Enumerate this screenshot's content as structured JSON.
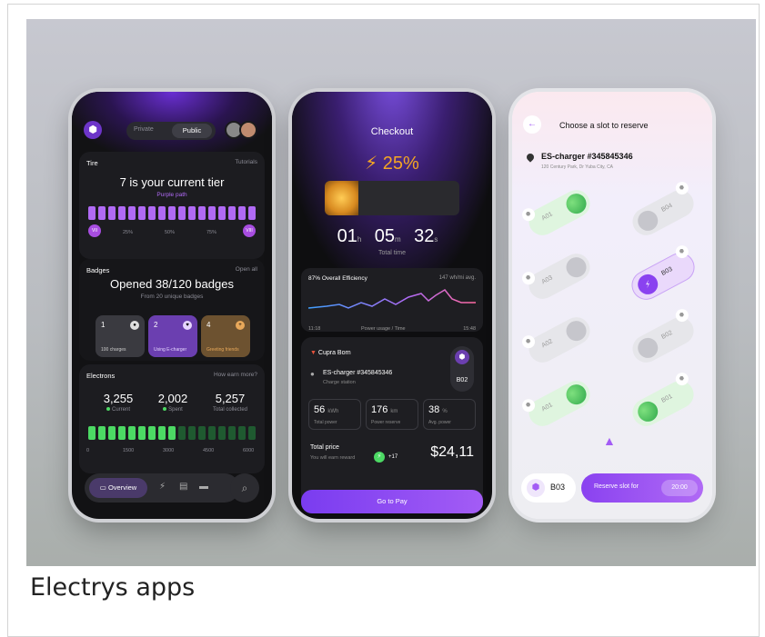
{
  "caption": "Electrys apps",
  "phone1": {
    "toggle": {
      "private_label": "Private",
      "public_label": "Public"
    },
    "tier_card": {
      "title": "Tire",
      "link": "Tutorials",
      "headline": "7 is your current tier",
      "subheadline": "Purple path",
      "scale": [
        "25%",
        "50%",
        "75%"
      ],
      "badge_start": "VII",
      "badge_end": "VIII",
      "progress_fraction": 1.0
    },
    "badges_card": {
      "title": "Badges",
      "link": "Open all",
      "headline": "Opened 38/120 badges",
      "subheadline": "From 20 unique badges",
      "tiles": [
        {
          "num": "1",
          "label": "100 charges",
          "color": "#3a3a40"
        },
        {
          "num": "2",
          "label": "Using E-charger",
          "color": "#6b3fb0"
        },
        {
          "num": "4",
          "label": "Greeting friends",
          "color": "#6d5230"
        }
      ]
    },
    "electrons_card": {
      "title": "Electrons",
      "link": "How earn more?",
      "stats": [
        {
          "value": "3,255",
          "label": "Current",
          "dot": "#4cd964"
        },
        {
          "value": "2,002",
          "label": "Spent",
          "dot": "#4cd964"
        },
        {
          "value": "5,257",
          "label": "Total collected",
          "dot": ""
        }
      ],
      "scale": [
        "0",
        "1500",
        "3000",
        "4500",
        "6000"
      ],
      "progress_fraction": 0.55
    },
    "nav": {
      "active_label": "Overview"
    }
  },
  "phone2": {
    "title": "Checkout",
    "percent": "25%",
    "battery_fraction": 0.25,
    "timer": {
      "h": "01",
      "h_unit": "h",
      "m": "05",
      "m_unit": "m",
      "s": "32",
      "s_unit": "s"
    },
    "timer_label": "Total time",
    "efficiency": {
      "title": "87% Overall Efficiency",
      "avg": "147 wh/mi avg.",
      "start": "11:18",
      "label": "Power usage / Time",
      "end": "15:48"
    },
    "car": {
      "name": "Cupra Born",
      "station": "ES-charger #345845346",
      "station_sub": "Charge station",
      "slot": "B02",
      "metrics": [
        {
          "value": "56",
          "unit": "kWh",
          "label": "Total power"
        },
        {
          "value": "176",
          "unit": "km",
          "label": "Power reserve"
        },
        {
          "value": "38",
          "unit": "%",
          "label": "Avg. power"
        }
      ],
      "total_label": "Total price",
      "reward_label": "You will earn reward",
      "reward_value": "+17",
      "price": "$24,11",
      "pay_button": "Go to Pay"
    }
  },
  "phone3": {
    "title": "Choose a slot to reserve",
    "station": "ES-charger #345845346",
    "address": "120 Century Park, Dr Yuba City, CA",
    "slots": [
      {
        "id": "A01",
        "state": "available"
      },
      {
        "id": "B04",
        "state": "occupied"
      },
      {
        "id": "A03",
        "state": "occupied"
      },
      {
        "id": "B03",
        "state": "selected"
      },
      {
        "id": "A02",
        "state": "occupied"
      },
      {
        "id": "B02",
        "state": "occupied"
      },
      {
        "id": "A01",
        "state": "available"
      },
      {
        "id": "B01",
        "state": "available"
      }
    ],
    "selected_slot": "B03",
    "reserve_label": "Reserve slot for",
    "reserve_time": "20:00"
  },
  "colors": {
    "accent": "#a35cf5",
    "green": "#4cd964",
    "orange": "#f5a623"
  }
}
